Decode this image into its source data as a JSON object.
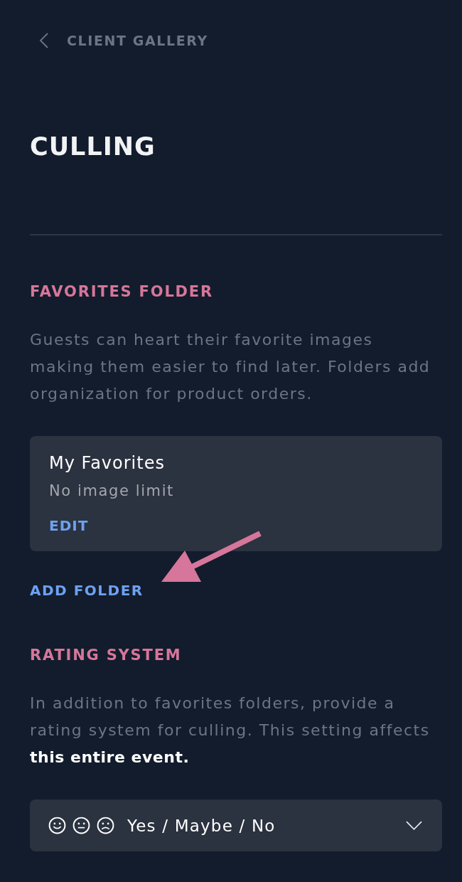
{
  "back_link": {
    "label": "CLIENT GALLERY"
  },
  "title": "CULLING",
  "sections": [
    {
      "kind": "folders",
      "heading": "FAVORITES FOLDER",
      "description": "Guests can heart their favorite images making them easier to find later. Folders add organization for product orders.",
      "folders": [
        {
          "name": "My Favorites",
          "limit": "No image limit",
          "edit_label": "EDIT"
        }
      ],
      "add_label": "ADD FOLDER"
    },
    {
      "kind": "select",
      "heading": "RATING SYSTEM",
      "description": "In addition to favorites folders, provide a rating system for culling. This setting affects **this entire event.**",
      "select": {
        "value": "Yes / Maybe / No"
      }
    }
  ]
}
